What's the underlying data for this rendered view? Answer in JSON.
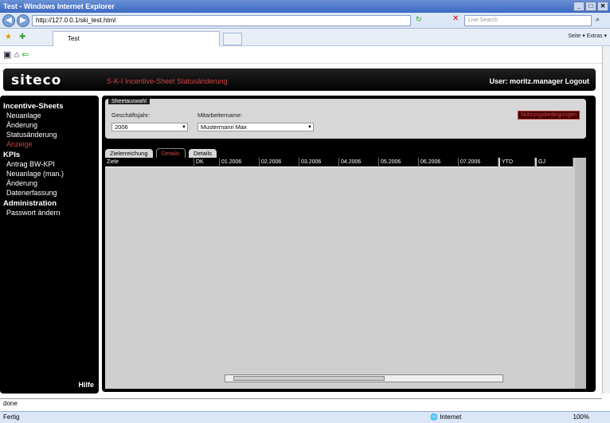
{
  "browser": {
    "title": "Test - Windows Internet Explorer",
    "url": "http://127.0.0.1/ski_test.html",
    "search_placeholder": "Live Search",
    "tab": "Test",
    "tools": "Seite ▾  Extras ▾"
  },
  "app": {
    "logo": "siteco",
    "title": "S-K-I Incentive-Sheet Statusänderung",
    "user": "User: moritz.manager Logout"
  },
  "sidebar": {
    "sec1": "Incentive-Sheets",
    "i1": [
      "Neuanlage",
      "Änderung",
      "Statusänderung",
      "Anzeige"
    ],
    "sec2": "KPIs",
    "i2": [
      "Antrag BW-KPI",
      "Neuanlage (man.)",
      "Änderung",
      "Datenerfassung"
    ],
    "sec3": "Administration",
    "i3": [
      "Passwort ändern"
    ],
    "help": "Hilfe"
  },
  "sheet": {
    "title": "Sheetauswahl",
    "year_label": "Geschäftsjahr:",
    "year": "2006",
    "emp_label": "Mitarbeitername:",
    "emp": "Mustermann Max",
    "nutz": "Nutzungsbedingungen"
  },
  "tabs": [
    "Zielerreichung",
    "Details",
    "Details"
  ],
  "table": {
    "headers": [
      "Ziele",
      "DK",
      "01.2006",
      "02.2006",
      "03.2006",
      "04.2006",
      "05.2006",
      "06.2006",
      "07.2006",
      "YTD",
      "GJ"
    ]
  },
  "status": {
    "left": "done",
    "bottom": "Fertig",
    "zone": "Internet",
    "zoom": "100%"
  }
}
